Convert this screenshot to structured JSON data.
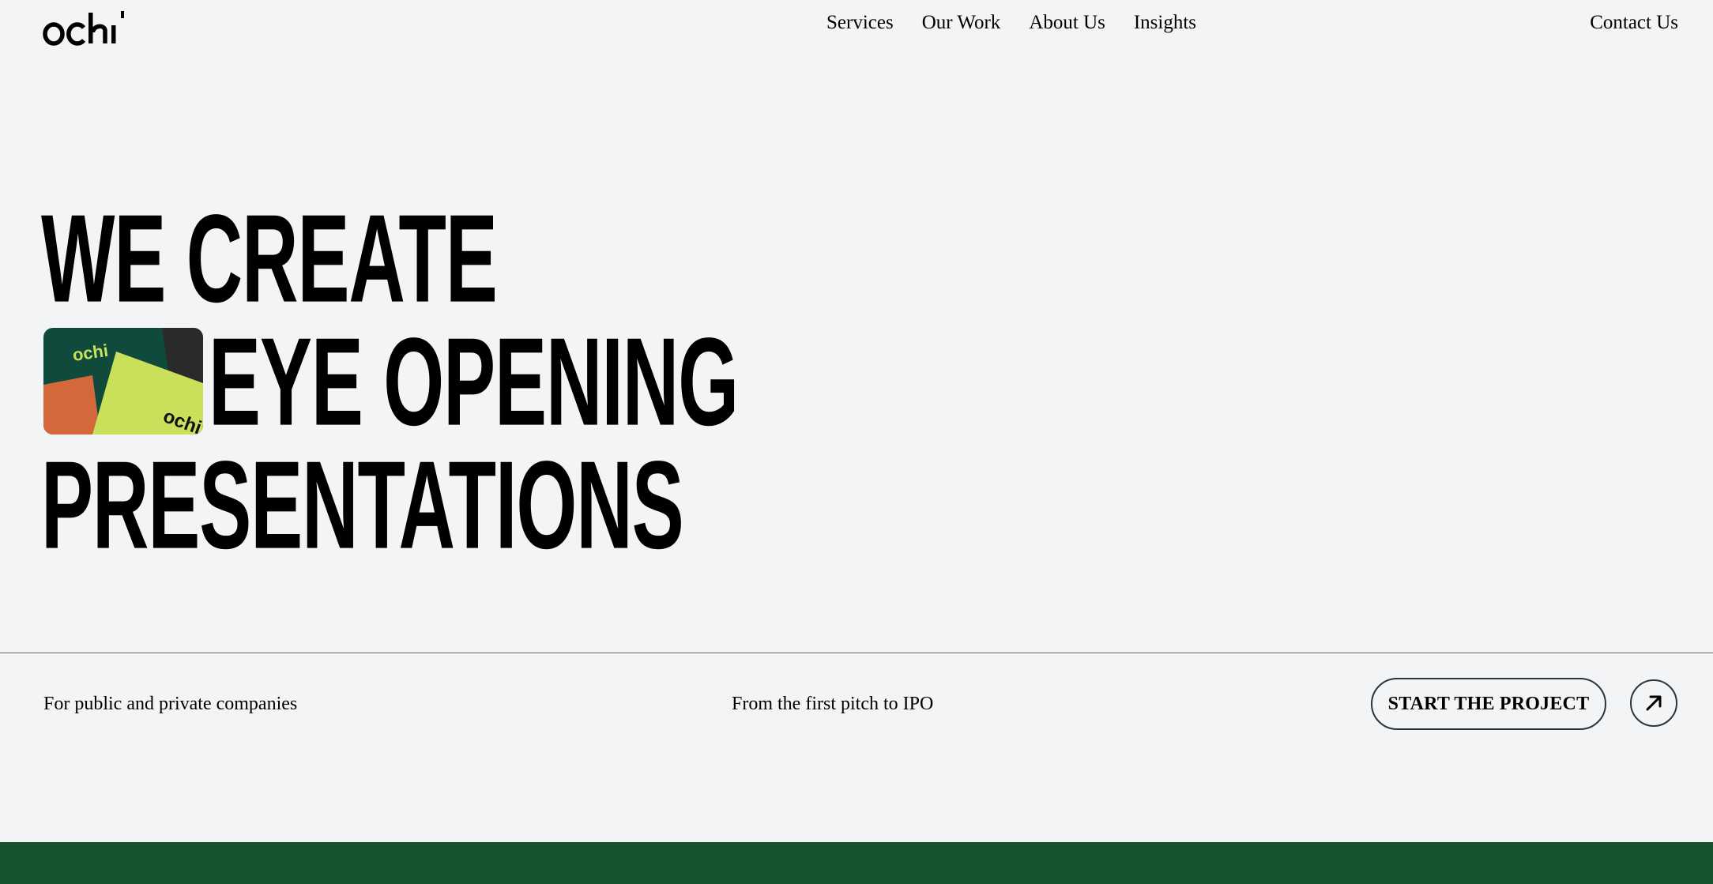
{
  "brand": {
    "logo_text": "ochi"
  },
  "nav": {
    "items": [
      {
        "label": "Services"
      },
      {
        "label": "Our Work"
      },
      {
        "label": "About Us"
      },
      {
        "label": "Insights"
      }
    ],
    "contact_label": "Contact Us"
  },
  "hero": {
    "line1": "WE CREATE",
    "line2": "EYE OPENING",
    "line3": "PRESENTATIONS",
    "thumb_logo_text": "ochi"
  },
  "sub": {
    "left": "For public and private companies",
    "middle": "From the first pitch to IPO",
    "cta_label": "START THE PROJECT",
    "cta_icon": "arrow-up-right-icon"
  },
  "colors": {
    "background": "#f3f4f6",
    "text": "#000000",
    "button_border": "#2d3340",
    "bottom_band": "#14532d",
    "thumb_dark_green": "#0f4a3c",
    "thumb_lime": "#c8e05a",
    "thumb_orange": "#d4683a"
  }
}
